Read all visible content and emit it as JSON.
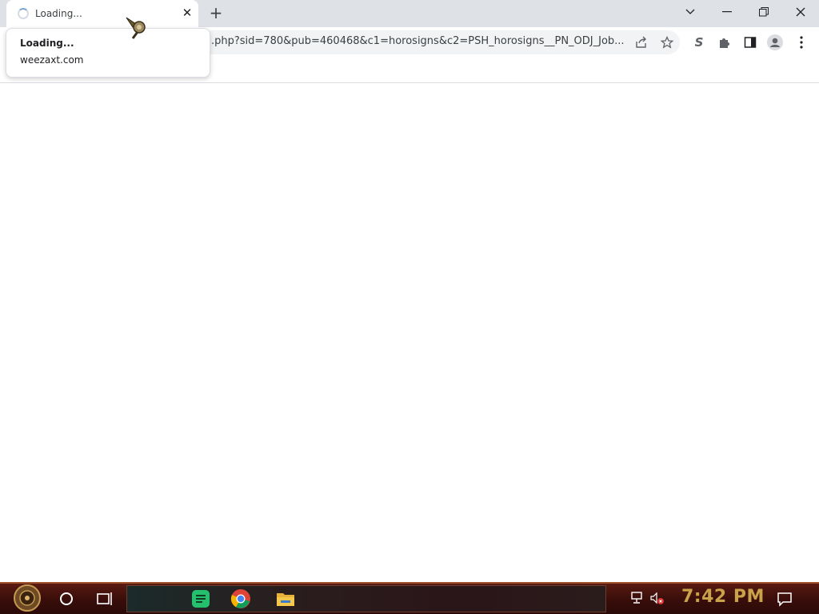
{
  "browser": {
    "tab": {
      "title": "Loading...",
      "close_icon": "close-icon"
    },
    "new_tab_icon": "plus-icon",
    "window_controls": [
      "tab-search-icon",
      "minimize-icon",
      "restore-icon",
      "close-icon"
    ],
    "address_bar": {
      "url": ".php?sid=780&pub=460468&c1=horosigns&c2=PSH_horosigns__PN_ODJ_Job..."
    },
    "toolbar_icons": [
      "share-icon",
      "bookmark-star-icon",
      "extension-s-icon",
      "extensions-puzzle-icon",
      "side-panel-icon",
      "profile-icon",
      "menu-icon"
    ],
    "hover_card": {
      "title": "Loading...",
      "domain": "weezaxt.com"
    }
  },
  "taskbar": {
    "apps": [
      "start-icon",
      "search-icon",
      "task-view-icon",
      "notes-app-icon",
      "chrome-icon",
      "file-explorer-icon"
    ],
    "tray": [
      "network-icon",
      "volume-muted-icon",
      "notification-icon"
    ],
    "clock": "7:42 PM",
    "accent": "#c9a24a"
  }
}
